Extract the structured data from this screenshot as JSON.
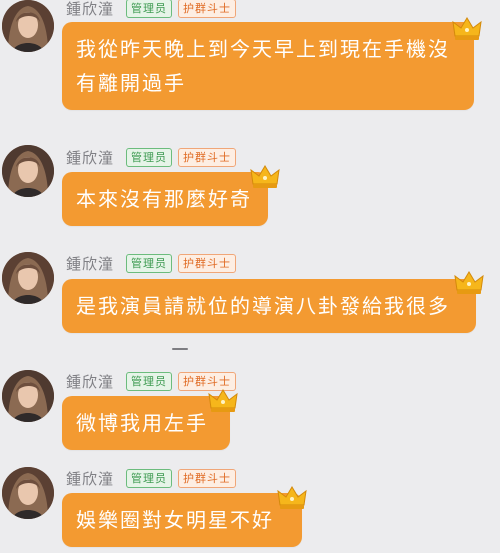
{
  "theme": {
    "background": "#ececee",
    "bubble_color": "#f39a31",
    "bubble_text_color": "#ffffff",
    "username_color": "#7f7f84",
    "admin_badge_color": "#3f9b52",
    "guard_badge_color": "#e06b24",
    "crown_color": "#f6b61b"
  },
  "messages": [
    {
      "sender": "鍾欣潼",
      "badges": [
        "管理员",
        "护群斗士"
      ],
      "text": "我從昨天晚上到今天早上到現在手機沒\n有離開過手",
      "icons": [
        "avatar",
        "crown-icon"
      ]
    },
    {
      "sender": "鍾欣潼",
      "badges": [
        "管理员",
        "护群斗士"
      ],
      "text": "本來沒有那麼好奇",
      "icons": [
        "avatar",
        "crown-icon"
      ]
    },
    {
      "sender": "鍾欣潼",
      "badges": [
        "管理员",
        "护群斗士"
      ],
      "text": "是我演員請就位的導演八卦發給我很多",
      "icons": [
        "avatar",
        "crown-icon"
      ]
    },
    {
      "sender": "鍾欣潼",
      "badges": [
        "管理员",
        "护群斗士"
      ],
      "text": "微博我用左手",
      "icons": [
        "avatar",
        "crown-icon"
      ]
    },
    {
      "sender": "鍾欣潼",
      "badges": [
        "管理员",
        "护群斗士"
      ],
      "text": "娛樂圈對女明星不好",
      "icons": [
        "avatar",
        "crown-icon"
      ]
    }
  ]
}
